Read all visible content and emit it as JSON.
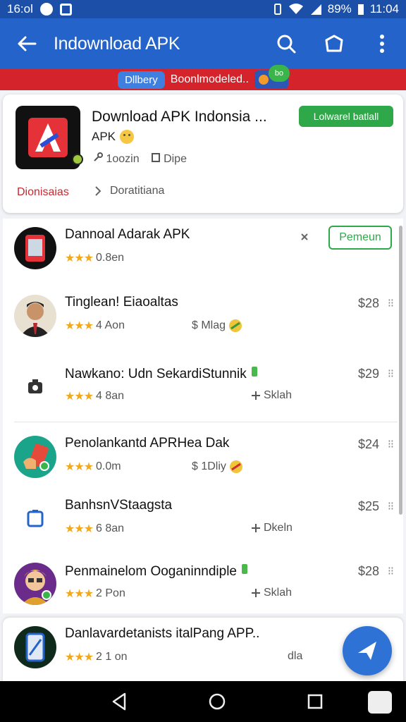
{
  "status_bar": {
    "time": "16:ol",
    "battery": "89%",
    "clock_right": "11:04",
    "icons": [
      "whatsapp-icon",
      "gallery-icon",
      "vibrate-icon",
      "wifi-icon",
      "signal-icon",
      "battery-icon"
    ]
  },
  "app_bar": {
    "title": "Indownload APK",
    "icons": [
      "back-arrow-icon",
      "search-icon",
      "shield-icon",
      "more-vert-icon"
    ]
  },
  "strip": {
    "chip1": "Dllbery",
    "chip2": "Boonlmodeled..",
    "mini_badge": "bo",
    "background": "#d4232b"
  },
  "featured": {
    "title": "Download APK Indonsia ...",
    "subtitle": "APK",
    "meta1": "1oozin",
    "meta2": "Dipe",
    "button": "Lolwarel batlall",
    "link_left": "Dionisaias",
    "link_right": "Doratitiana"
  },
  "list": [
    {
      "name": "Dannoal Adarak APK",
      "rating_text": "0.8en",
      "stars": "★★★",
      "action": "Pemeun",
      "pin": true
    },
    {
      "name": "Tinglean! Eiaoaltas",
      "rating_text": "4 Aon",
      "stars": "★★★",
      "meta": "$ Mlag",
      "price": "$28"
    },
    {
      "name": "Nawkano: Udn SekardiStunnik",
      "rating_text": "4 8an",
      "stars": "★★★",
      "meta": "Sklah",
      "price": "$29"
    },
    {
      "name": "Penolankantd APRHea Dak",
      "rating_text": "0.0m",
      "stars": "★★★",
      "meta": "$ 1Dliy",
      "price": "$24"
    },
    {
      "name": "BanhsnVStaagsta",
      "rating_text": "6 8an",
      "stars": "★★★",
      "meta": "Dkeln",
      "price": "$25"
    },
    {
      "name": "Penmainelom Ooganinndiple",
      "rating_text": "2 Pon",
      "stars": "★★★",
      "meta": "Sklah",
      "price": "$28"
    }
  ],
  "last_card": {
    "name": "Danlavardetanists italPang APP..",
    "rating_text": "2 1 on",
    "stars": "★★★",
    "meta": "dla"
  },
  "colors": {
    "primary": "#2463c9",
    "accent_green": "#2fa84a",
    "star": "#f0a91c"
  }
}
